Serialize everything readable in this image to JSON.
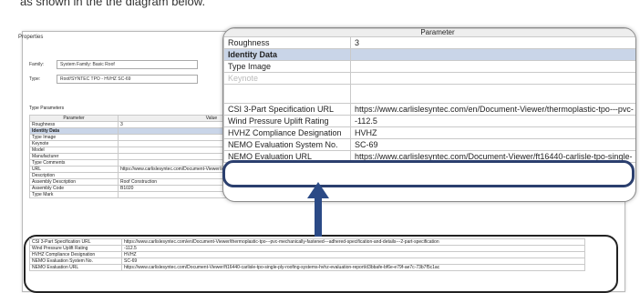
{
  "caption": "as shown in the  the diagram below.",
  "dialog": {
    "title": "Properties",
    "family_label": "Family:",
    "family_value": "System Family: Basic Roof",
    "type_label": "Type:",
    "type_value": "Roof/SYNTEC TPO - HVHZ SC-69",
    "type_parameters_label": "Type Parameters"
  },
  "bg_table": {
    "header": [
      "Parameter",
      "Value",
      ""
    ],
    "rows": [
      {
        "name": "Roughness",
        "value": "3",
        "extra": ""
      },
      {
        "name": "Identity Data",
        "value": "",
        "extra": "",
        "group": true
      },
      {
        "name": "Type Image",
        "value": "",
        "extra": ""
      },
      {
        "name": "Keynote",
        "value": "",
        "extra": ""
      },
      {
        "name": "Model",
        "value": "",
        "extra": ""
      },
      {
        "name": "Manufacturer",
        "value": "",
        "extra": ""
      },
      {
        "name": "Type Comments",
        "value": "",
        "extra": ""
      },
      {
        "name": "URL",
        "value": "https://www.carlislesyntec.com/Document-Viewer/sure-weld-tpo-fully-adhered-system-sheet/d3f3b-f78e-5a1f-9a-d1ecb2",
        "extra": ""
      },
      {
        "name": "Description",
        "value": "",
        "extra": ""
      },
      {
        "name": "Assembly Description",
        "value": "Roof Construction",
        "extra": ""
      },
      {
        "name": "Assembly Code",
        "value": "B1020",
        "extra": ""
      },
      {
        "name": "Type Mark",
        "value": "",
        "extra": ""
      }
    ]
  },
  "bot_table": {
    "rows": [
      {
        "name": "CSI 3-Part Specification URL",
        "value": "https://www.carlislesyntec.com/en/Document-Viewer/thermoplastic-tpo---pvc-mechanically-fastened---adhered-specification-and-details---2-part-specification"
      },
      {
        "name": "Wind Pressure Uplift Rating",
        "value": "-112.5"
      },
      {
        "name": "HVHZ Compliance Designation",
        "value": "HVHZ"
      },
      {
        "name": "NEMO Evaluation System No.",
        "value": "SC-69"
      },
      {
        "name": "NEMO Evaluation URL",
        "value": "https://www.carlislesyntec.com/Document-Viewer/ft16440-carlisle-tpo-single-ply-roofing-systems-hvhz-evaluation-report/d3bbafe-bf6e-e79f-ae7c-73b7f5c1ac"
      }
    ]
  },
  "zoom": {
    "header": "Parameter",
    "rows": [
      {
        "name": "Roughness",
        "value": "3"
      },
      {
        "name": "Identity Data",
        "value": "",
        "group": true
      },
      {
        "name": "Type Image",
        "value": ""
      },
      {
        "name": "Keynote",
        "value": "",
        "faded": true
      },
      {
        "name": "",
        "value": "",
        "gap": true
      },
      {
        "name": "CSI 3-Part Specification URL",
        "value": "https://www.carlislesyntec.com/en/Document-Viewer/thermoplastic-tpo---pvc-"
      },
      {
        "name": "Wind Pressure Uplift Rating",
        "value": "-112.5"
      },
      {
        "name": "HVHZ Compliance Designation",
        "value": "HVHZ"
      },
      {
        "name": "NEMO Evaluation System No.",
        "value": "SC-69"
      },
      {
        "name": "NEMO Evaluation URL",
        "value": "https://www.carlislesyntec.com/Document-Viewer/ft16440-carlisle-tpo-single-"
      }
    ]
  },
  "colors": {
    "highlight_border": "#2b3f6e",
    "group_bg": "#c9d5e8",
    "arrow": "#2b4a86"
  },
  "icons": {
    "arrow": "up-arrow-icon"
  }
}
